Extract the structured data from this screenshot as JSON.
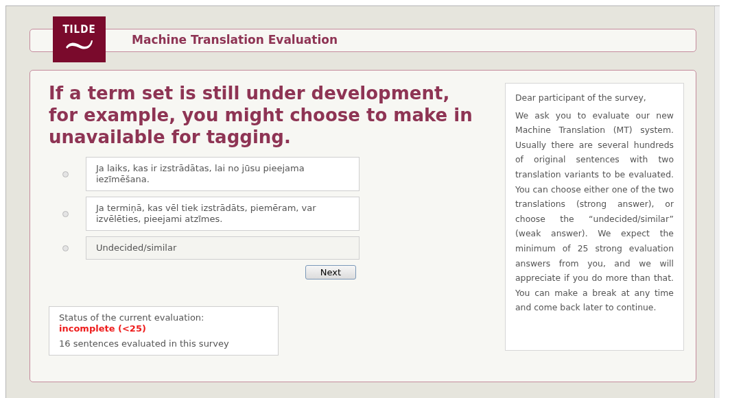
{
  "logo": {
    "text": "TILDE"
  },
  "header": {
    "title": "Machine Translation Evaluation"
  },
  "question": "If a term set is still under development, for example, you might choose to make in unavailable for tagging.",
  "options": [
    {
      "text": "Ja laiks, kas ir izstrādātas, lai no jūsu pieejama iezīmēšana.",
      "selected": false,
      "kind": "translation"
    },
    {
      "text": "Ja termiņā, kas vēl tiek izstrādāts, piemēram, var izvēlēties, pieejami atzīmes.",
      "selected": false,
      "kind": "translation"
    },
    {
      "text": "Undecided/similar",
      "selected": false,
      "kind": "undecided"
    }
  ],
  "next_button": "Next",
  "status": {
    "label": "Status of the current evaluation:",
    "value": "incomplete (<25)",
    "count": "16 sentences evaluated in this survey"
  },
  "info": {
    "greeting": "Dear participant of the survey,",
    "body": "We ask you to evaluate our new Machine Translation (MT) system. Usually there are several hundreds of original sentences with two translation variants to be evaluated. You can choose either one of the two translations (strong answer), or choose the “undecided/similar” (weak answer). We expect the minimum of 25 strong evaluation answers from you, and we will appreciate if you do more than that. You can make a break at any time and come back later to continue."
  }
}
